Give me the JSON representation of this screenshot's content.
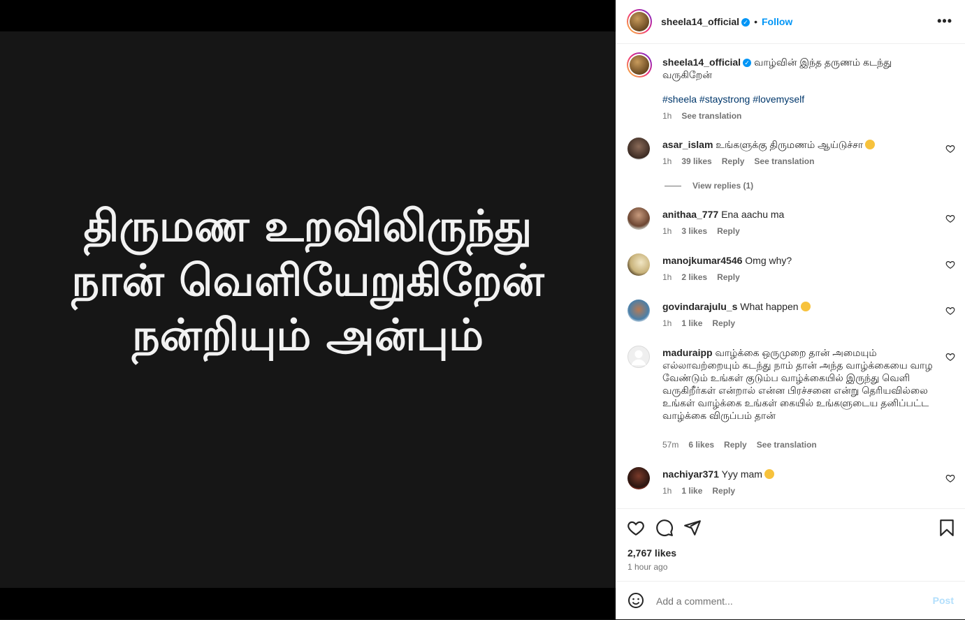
{
  "post": {
    "lines": [
      "திருமண உறவிலிருந்து",
      "நான் வெளியேறுகிறேன்",
      "நன்றியும் அன்பும்"
    ]
  },
  "header": {
    "username": "sheela14_official",
    "separator": "•",
    "follow_label": "Follow",
    "more_label": "•••"
  },
  "caption": {
    "username": "sheela14_official",
    "text": "வாழ்வின் இந்த தருணம் கடந்து வருகிறேன்",
    "hashtags": "#sheela #staystrong #lovemyself",
    "time": "1h",
    "see_translation": "See translation"
  },
  "comments": [
    {
      "username": "asar_islam",
      "text": "உங்களுக்கு திருமணம் ஆய்டுச்சா",
      "time": "1h",
      "likes": "39 likes",
      "reply": "Reply",
      "see_translation": "See translation",
      "view_replies": "View replies (1)"
    },
    {
      "username": "anithaa_777",
      "text": "Ena aachu ma",
      "time": "1h",
      "likes": "3 likes",
      "reply": "Reply"
    },
    {
      "username": "manojkumar4546",
      "text": "Omg why?",
      "time": "1h",
      "likes": "2 likes",
      "reply": "Reply"
    },
    {
      "username": "govindarajulu_s",
      "text": "What happen",
      "time": "1h",
      "likes": "1 like",
      "reply": "Reply"
    },
    {
      "username": "maduraipp",
      "text": "வாழ்க்கை ஒருமுறை தான் அமையும் எல்லாவற்றையும் கடந்து நாம் தான் அந்த வாழ்க்கையை வாழ வேண்டும் உங்கள் குடும்ப வாழ்க்கையில் இருந்து வெளி வருகிறீர்கள் என்றால் என்ன பிரச்சனை என்று தெரியவில்லை உங்கள் வாழ்க்கை உங்கள் கையில் உங்களுடைய தனிப்பட்ட வாழ்க்கை விருப்பம் தான்",
      "time": "57m",
      "likes": "6 likes",
      "reply": "Reply",
      "see_translation": "See translation"
    },
    {
      "username": "nachiyar371",
      "text": "Yyy mam",
      "time": "1h",
      "likes": "1 like",
      "reply": "Reply"
    }
  ],
  "footer": {
    "likes": "2,767 likes",
    "ago": "1 hour ago",
    "add_comment_placeholder": "Add a comment...",
    "post_label": "Post"
  },
  "colors": {
    "accent": "#0095f6",
    "hashtag": "#00376b",
    "muted": "#737373",
    "media_bg": "#161616"
  }
}
